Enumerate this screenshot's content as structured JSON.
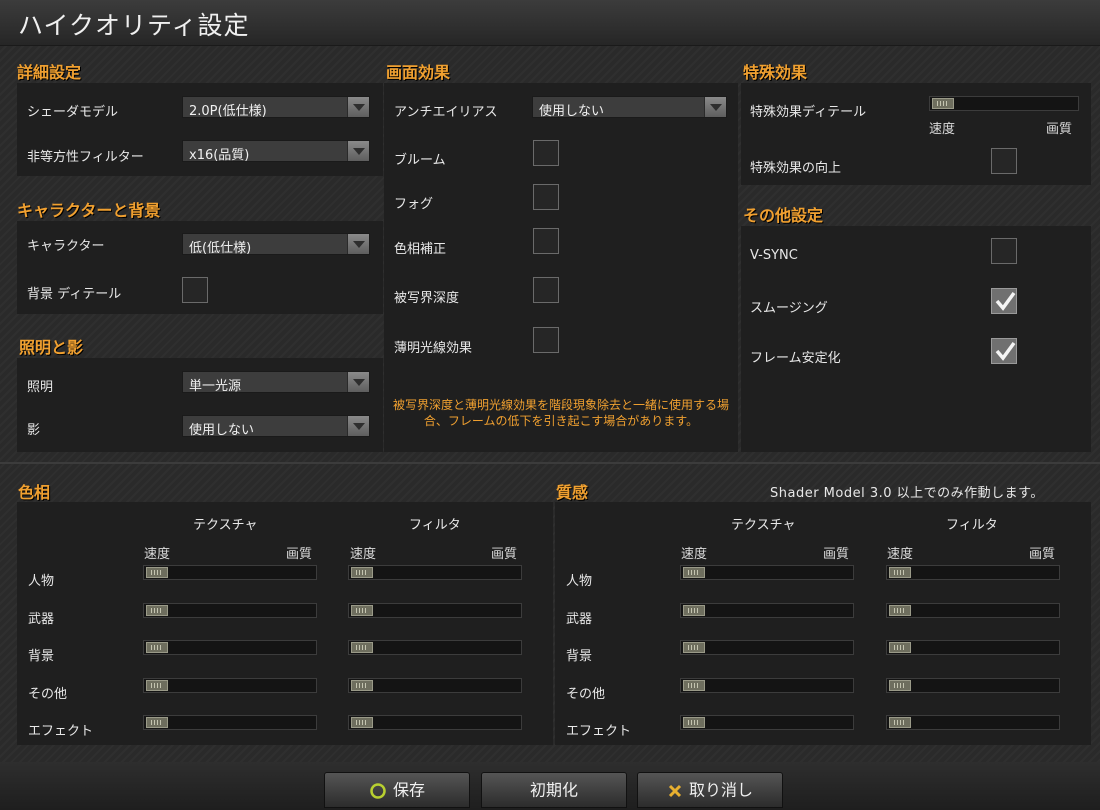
{
  "window": {
    "title": "ハイクオリティ設定"
  },
  "detail": {
    "title": "詳細設定",
    "shader_label": "シェーダモデル",
    "shader_value": "2.0P(低仕様)",
    "aniso_label": "非等方性フィルター",
    "aniso_value": "x16(品質)"
  },
  "charbg": {
    "title": "キャラクターと背景",
    "character_label": "キャラクター",
    "character_value": "低(低仕様)",
    "bgdetail_label": "背景 ディテール"
  },
  "lighting": {
    "title": "照明と影",
    "light_label": "照明",
    "light_value": "単一光源",
    "shadow_label": "影",
    "shadow_value": "使用しない"
  },
  "screen": {
    "title": "画面効果",
    "aa_label": "アンチエイリアス",
    "aa_value": "使用しない",
    "bloom_label": "ブルーム",
    "fog_label": "フォグ",
    "color_label": "色相補正",
    "dof_label": "被写界深度",
    "light_shaft_label": "薄明光線効果",
    "note": "被写界深度と薄明光線効果を階段現象除去と一緒に使用する場合、フレームの低下を引き起こす場合があります。"
  },
  "special": {
    "title": "特殊効果",
    "detail_label": "特殊効果ディテール",
    "speed_label": "速度",
    "quality_label": "画質",
    "detail_level": 0,
    "improve_label": "特殊効果の向上"
  },
  "other": {
    "title": "その他設定",
    "vsync_label": "V-SYNC",
    "vsync_checked": false,
    "smoothing_label": "スムージング",
    "smoothing_checked": true,
    "framestab_label": "フレーム安定化",
    "framestab_checked": true
  },
  "hue": {
    "title": "色相",
    "texture_header": "テクスチャ",
    "filter_header": "フィルタ",
    "speed_label": "速度",
    "quality_label": "画質",
    "rows": [
      "人物",
      "武器",
      "背景",
      "その他",
      "エフェクト"
    ]
  },
  "texture_q": {
    "title": "質感",
    "shader_note": "Shader Model 3.0 以上でのみ作動します。",
    "texture_header": "テクスチャ",
    "filter_header": "フィルタ",
    "speed_label": "速度",
    "quality_label": "画質",
    "rows": [
      "人物",
      "武器",
      "背景",
      "その他",
      "エフェクト"
    ]
  },
  "buttons": {
    "save": "保存",
    "reset": "初期化",
    "cancel": "取り消し"
  },
  "colors": {
    "accent": "#f0a030",
    "panel": "#1f1f1f",
    "check_accept": "#b8d030",
    "cancel_x": "#e8b030"
  },
  "icons": {
    "save": "circle-icon",
    "cancel": "x-icon",
    "checkbox": "checkmark-icon"
  }
}
